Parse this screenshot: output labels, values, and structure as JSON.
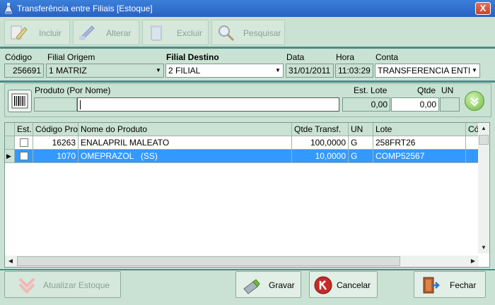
{
  "window": {
    "title": "Transferência entre Filiais [Estoque]",
    "close_glyph": "X"
  },
  "toolbar": {
    "incluir": "Incluir",
    "alterar": "Alterar",
    "excluir": "Excluir",
    "pesquisar": "Pesquisar"
  },
  "header": {
    "codigo_label": "Código",
    "codigo_value": "256691",
    "origem_label": "Filial Origem",
    "origem_value": "1 MATRIZ",
    "destino_label": "Filial Destino",
    "destino_value": "2 FILIAL",
    "data_label": "Data",
    "data_value": "31/01/2011",
    "hora_label": "Hora",
    "hora_value": "11:03:29",
    "conta_label": "Conta",
    "conta_value": "TRANSFERENCIA ENTRE"
  },
  "product": {
    "nome_label": "Produto (Por Nome)",
    "nome_value": "",
    "est_lote_label": "Est. Lote",
    "est_lote_value": "0,00",
    "qtde_label": "Qtde",
    "qtde_value": "0,00",
    "un_label": "UN",
    "un_value": ""
  },
  "grid": {
    "columns": [
      "Est.",
      "Código Pro",
      "Nome do Produto",
      "Qtde Transf.",
      "UN",
      "Lote",
      "Có"
    ],
    "rows": [
      {
        "codigo": "16263",
        "nome": "ENALAPRIL MALEATO",
        "qtde": "100,0000",
        "un": "G",
        "lote": "258FRT26"
      },
      {
        "codigo": "1070",
        "nome": "OMEPRAZOL   (SS)",
        "qtde": "10,0000",
        "un": "G",
        "lote": "COMP52567"
      }
    ]
  },
  "footer": {
    "atualizar": "Atualizar Estoque",
    "gravar": "Gravar",
    "cancelar": "Cancelar",
    "fechar": "Fechar"
  },
  "colors": {
    "accent": "#3399ff",
    "background": "#c9e2d3",
    "separator": "#4d8a88",
    "titlebar": "#2a62c2"
  }
}
